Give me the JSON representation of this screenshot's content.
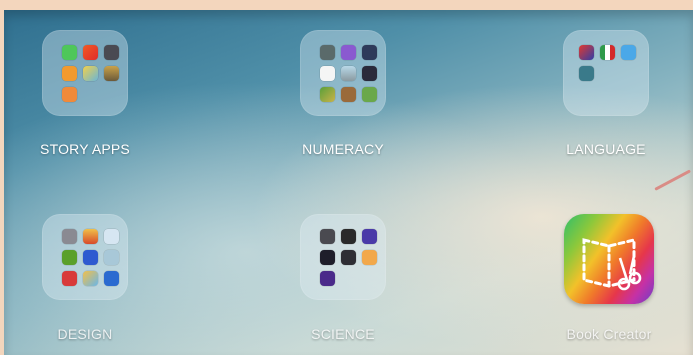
{
  "folders": {
    "story_apps": {
      "label": "STORY APPS"
    },
    "numeracy": {
      "label": "NUMERACY"
    },
    "language": {
      "label": "LANGUAGE"
    },
    "design": {
      "label": "DESIGN"
    },
    "science": {
      "label": "SCIENCE"
    }
  },
  "apps": {
    "book_creator": {
      "label": "Book Creator",
      "icon": "book-scissors-icon"
    }
  },
  "colors": {
    "wallpaper_top": "#2f6f8f",
    "wallpaper_bottom": "#e7e1d2",
    "annotation_line": "#d98c86"
  }
}
